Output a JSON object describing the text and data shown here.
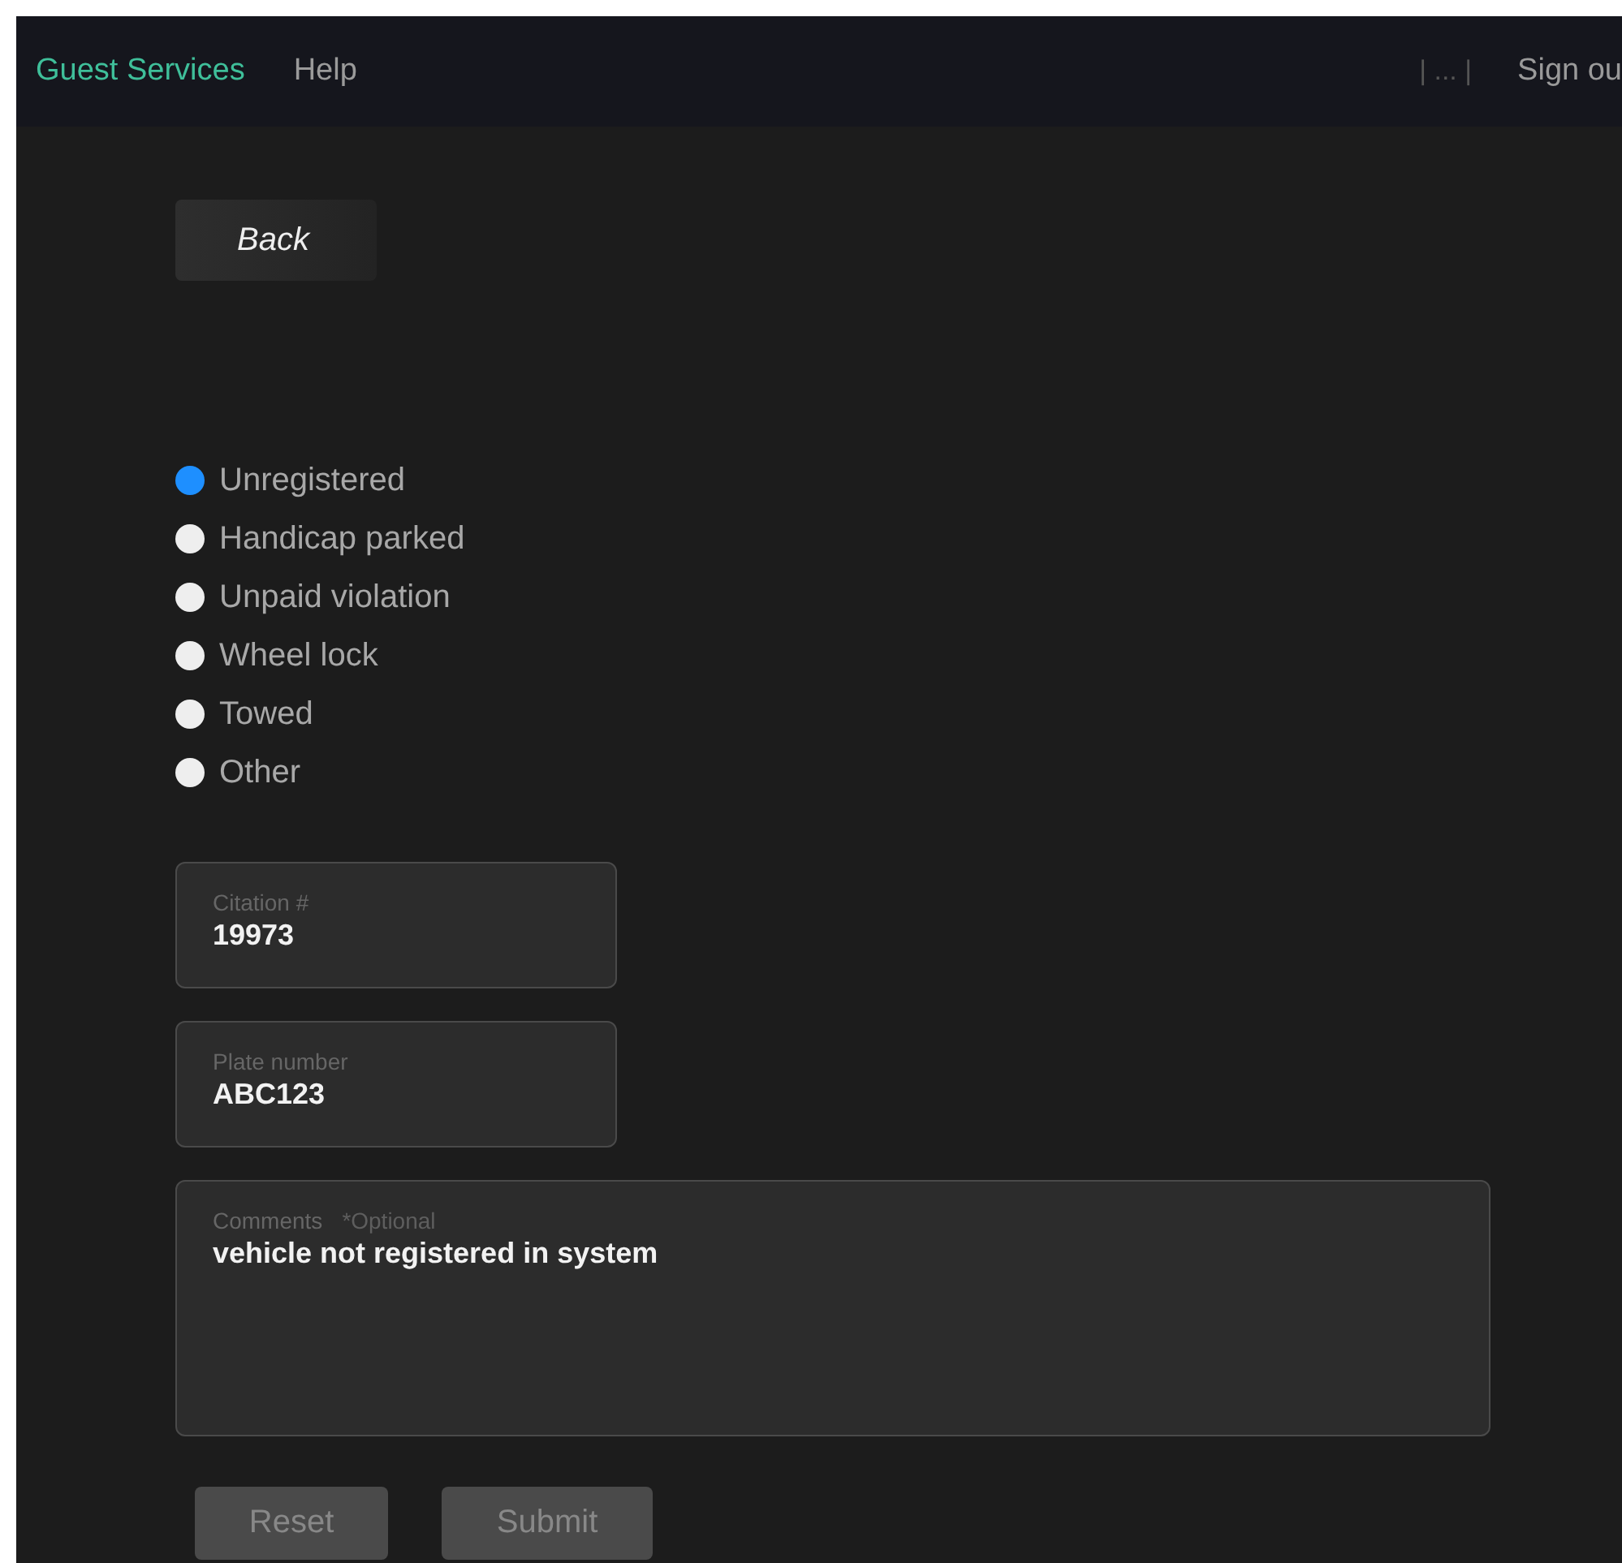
{
  "nav": {
    "brand": "Guest Services",
    "links": [
      {
        "label": "Help"
      }
    ],
    "right": [
      {
        "label": "| ... |",
        "kind": "separator"
      },
      {
        "label": "Sign ou",
        "kind": "link"
      }
    ]
  },
  "back_button": "Back",
  "reasons": [
    {
      "label": "Unregistered",
      "selected": true
    },
    {
      "label": "Handicap parked",
      "selected": false
    },
    {
      "label": "Unpaid violation",
      "selected": false
    },
    {
      "label": "Wheel lock",
      "selected": false
    },
    {
      "label": "Towed",
      "selected": false
    },
    {
      "label": "Other",
      "selected": false
    }
  ],
  "fields": [
    {
      "label": "Citation #",
      "value": "19973"
    },
    {
      "label": "Plate number",
      "value": "ABC123"
    }
  ],
  "comments": {
    "label": "Comments",
    "note": "*Optional",
    "value": "vehicle not registered in system"
  },
  "buttons": [
    {
      "label": "Reset",
      "disabled": true
    },
    {
      "label": "Submit",
      "disabled": true
    }
  ]
}
